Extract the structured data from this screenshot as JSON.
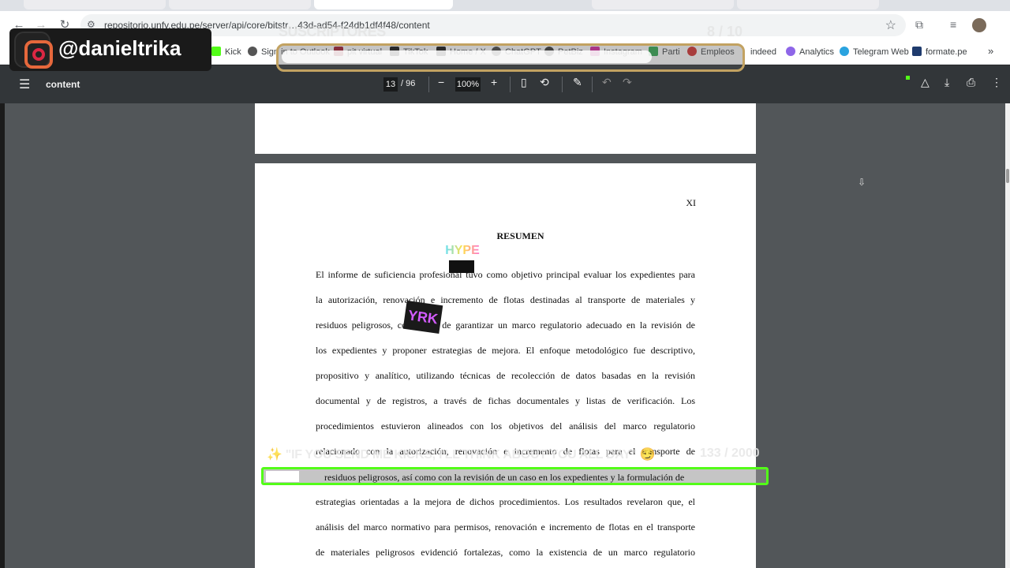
{
  "browser": {
    "url": "repositorio.unfv.edu.pe/server/api/core/bitstr…43d-ad54-f24db1df4f48/content",
    "bookmarks": [
      "Kick",
      "Sign in to Outlook",
      "pit virtual",
      "TikTok",
      "Home / X",
      "ChatGPT",
      "PetBiz",
      "Instagram",
      "Parti",
      "Empleos",
      "indeed",
      "Analytics",
      "Telegram Web",
      "formate.pe"
    ],
    "more_bookmarks_icon": "chevron-double-right-icon"
  },
  "pdf_toolbar": {
    "title": "content",
    "current_page": "13",
    "total_pages": "/ 96",
    "zoom": "100%"
  },
  "page": {
    "number": "XI",
    "heading": "RESUMEN",
    "lines": [
      "El informe de suficiencia profesional tuvo como objetivo principal evaluar los expedientes para",
      "la autorización, renovación e incremento de flotas destinadas al transporte de materiales y",
      "residuos peligrosos, con el fin de garantizar un marco regulatorio adecuado en la revisión de",
      "los expedientes y proponer estrategias de mejora. El enfoque metodológico fue descriptivo,",
      "propositivo y analítico, utilizando técnicas de recolección de datos basadas en la revisión",
      "documental y de registros, a través de fichas documentales y listas de verificación. Los",
      "procedimientos estuvieron alineados con los objetivos del análisis del marco regulatorio",
      "relacionado con la autorización, renovación e incremento de flotas para el transporte de",
      "residuos peligrosos, así como con la revisión de un caso en los expedientes y la formulación de",
      "estrategias orientadas a la mejora de dichos procedimientos. Los resultados revelaron que, el",
      "análisis del marco normativo para permisos, renovación e incremento de flotas en el transporte",
      "de materiales peligrosos evidenció fortalezas, como la existencia de un marco regulatorio"
    ]
  },
  "overlays": {
    "instagram_handle": "@danieltrika",
    "subs_label": "SUSCRIPTORES",
    "subs_count": "8 / 10",
    "subs_progress": 0.8,
    "hype_label": "HYPE",
    "york_label": "YRK",
    "kick_goal_label": "\"IF YOU SEND ME KICKS, I'LL THINK ABOUT YOU ALL DAY\"",
    "kick_goal_count": "133 / 2000",
    "kick_progress": 0.0665
  }
}
